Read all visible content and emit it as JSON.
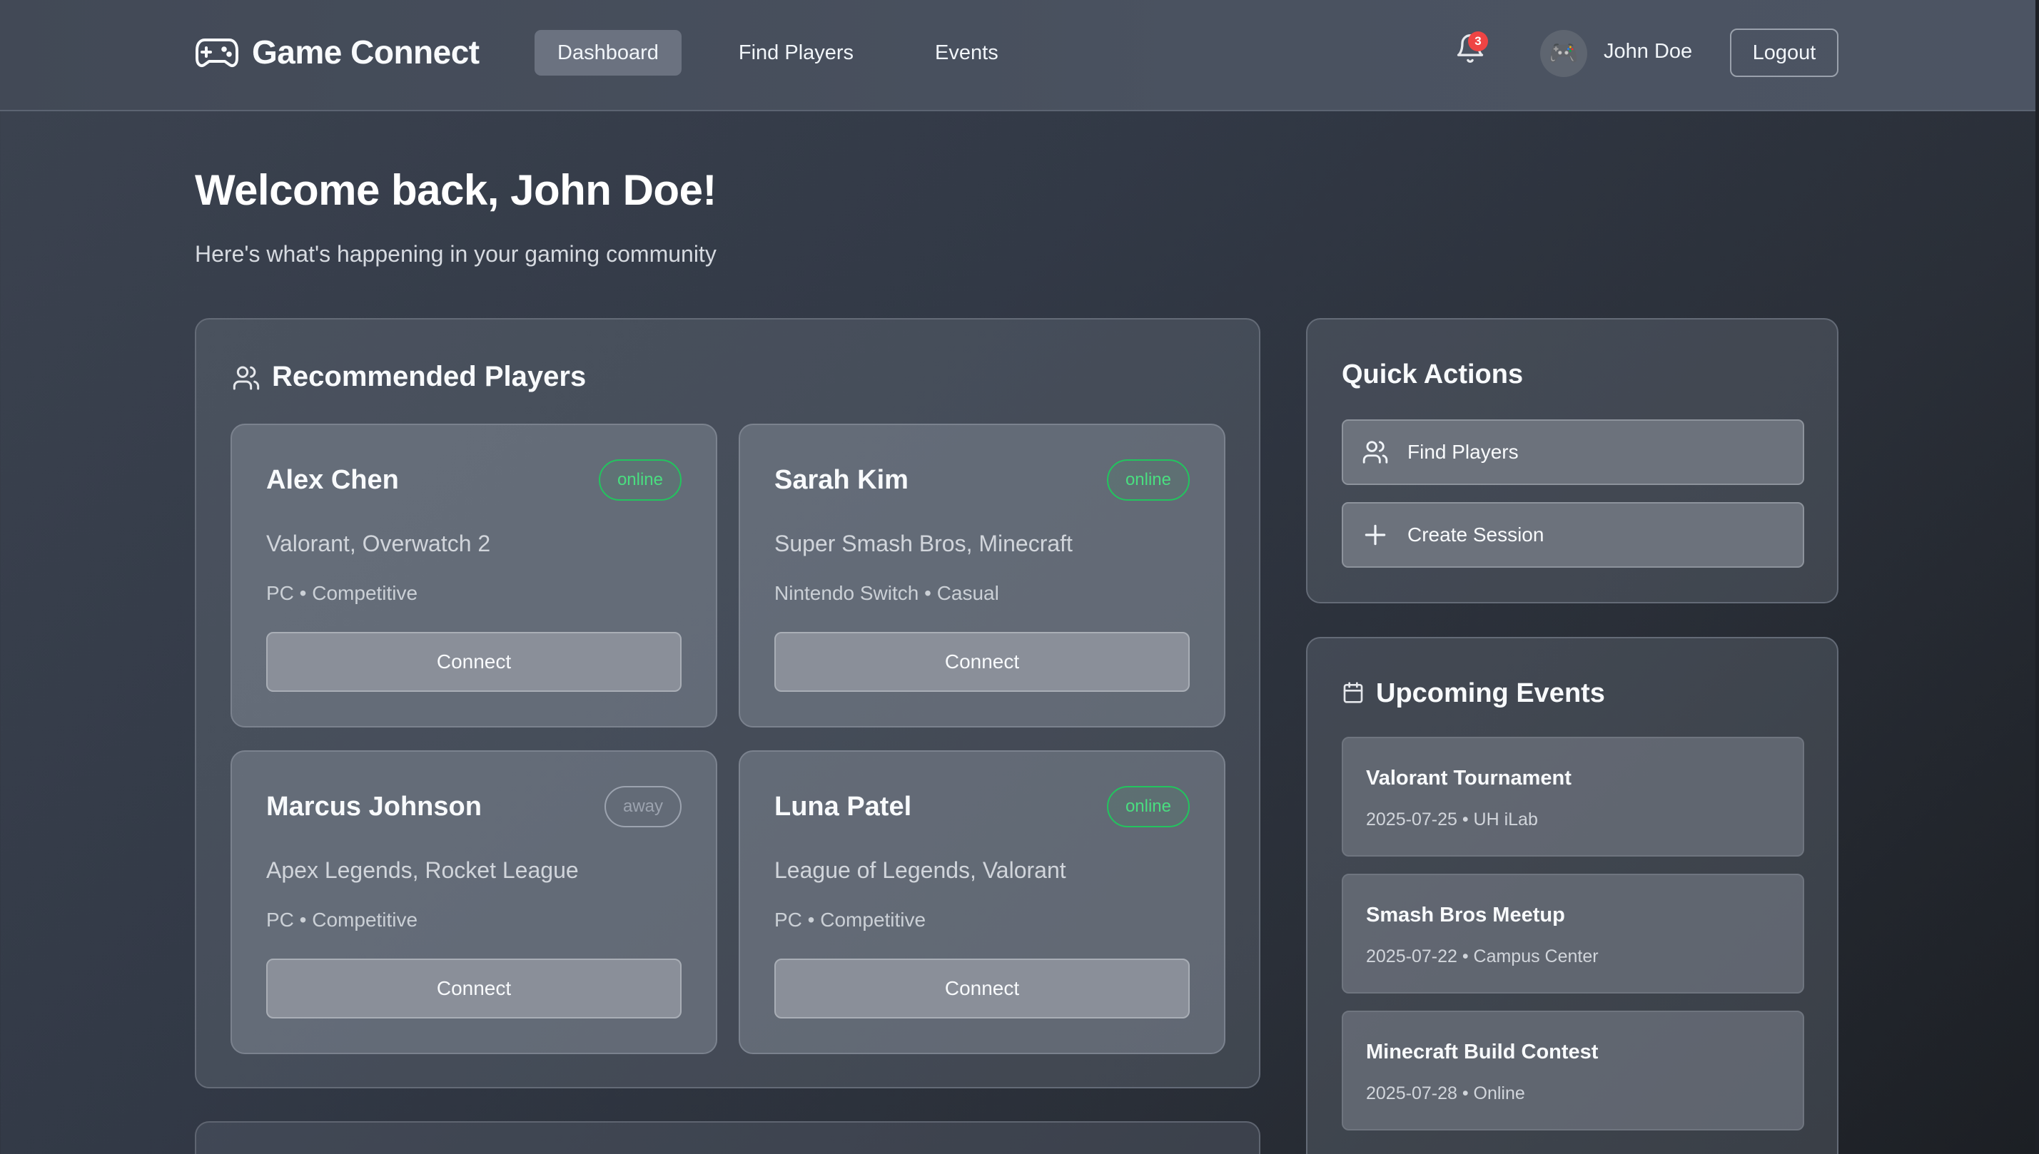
{
  "app": {
    "name": "Game Connect"
  },
  "nav": {
    "items": [
      {
        "label": "Dashboard",
        "active": true
      },
      {
        "label": "Find Players",
        "active": false
      },
      {
        "label": "Events",
        "active": false
      }
    ]
  },
  "header": {
    "notification_count": "3",
    "avatar_emoji": "🎮",
    "user_name": "John Doe",
    "logout_label": "Logout"
  },
  "welcome": {
    "title": "Welcome back, John Doe!",
    "subtitle": "Here's what's happening in your gaming community"
  },
  "recommended": {
    "title": "Recommended Players",
    "players": [
      {
        "name": "Alex Chen",
        "status": "online",
        "games": "Valorant, Overwatch 2",
        "meta": "PC • Competitive",
        "button": "Connect"
      },
      {
        "name": "Sarah Kim",
        "status": "online",
        "games": "Super Smash Bros, Minecraft",
        "meta": "Nintendo Switch • Casual",
        "button": "Connect"
      },
      {
        "name": "Marcus Johnson",
        "status": "away",
        "games": "Apex Legends, Rocket League",
        "meta": "PC • Competitive",
        "button": "Connect"
      },
      {
        "name": "Luna Patel",
        "status": "online",
        "games": "League of Legends, Valorant",
        "meta": "PC • Competitive",
        "button": "Connect"
      }
    ]
  },
  "quick_actions": {
    "title": "Quick Actions",
    "items": [
      {
        "label": "Find Players",
        "icon": "users-icon"
      },
      {
        "label": "Create Session",
        "icon": "plus-icon"
      }
    ]
  },
  "upcoming_events": {
    "title": "Upcoming Events",
    "events": [
      {
        "title": "Valorant Tournament",
        "meta": "2025-07-25 • UH iLab"
      },
      {
        "title": "Smash Bros Meetup",
        "meta": "2025-07-22 • Campus Center"
      },
      {
        "title": "Minecraft Build Contest",
        "meta": "2025-07-28 • Online"
      }
    ]
  },
  "colors": {
    "online": "#22c55e",
    "away": "#9ca3af",
    "badge": "#ef4444",
    "active_nav": "#6b7280"
  }
}
